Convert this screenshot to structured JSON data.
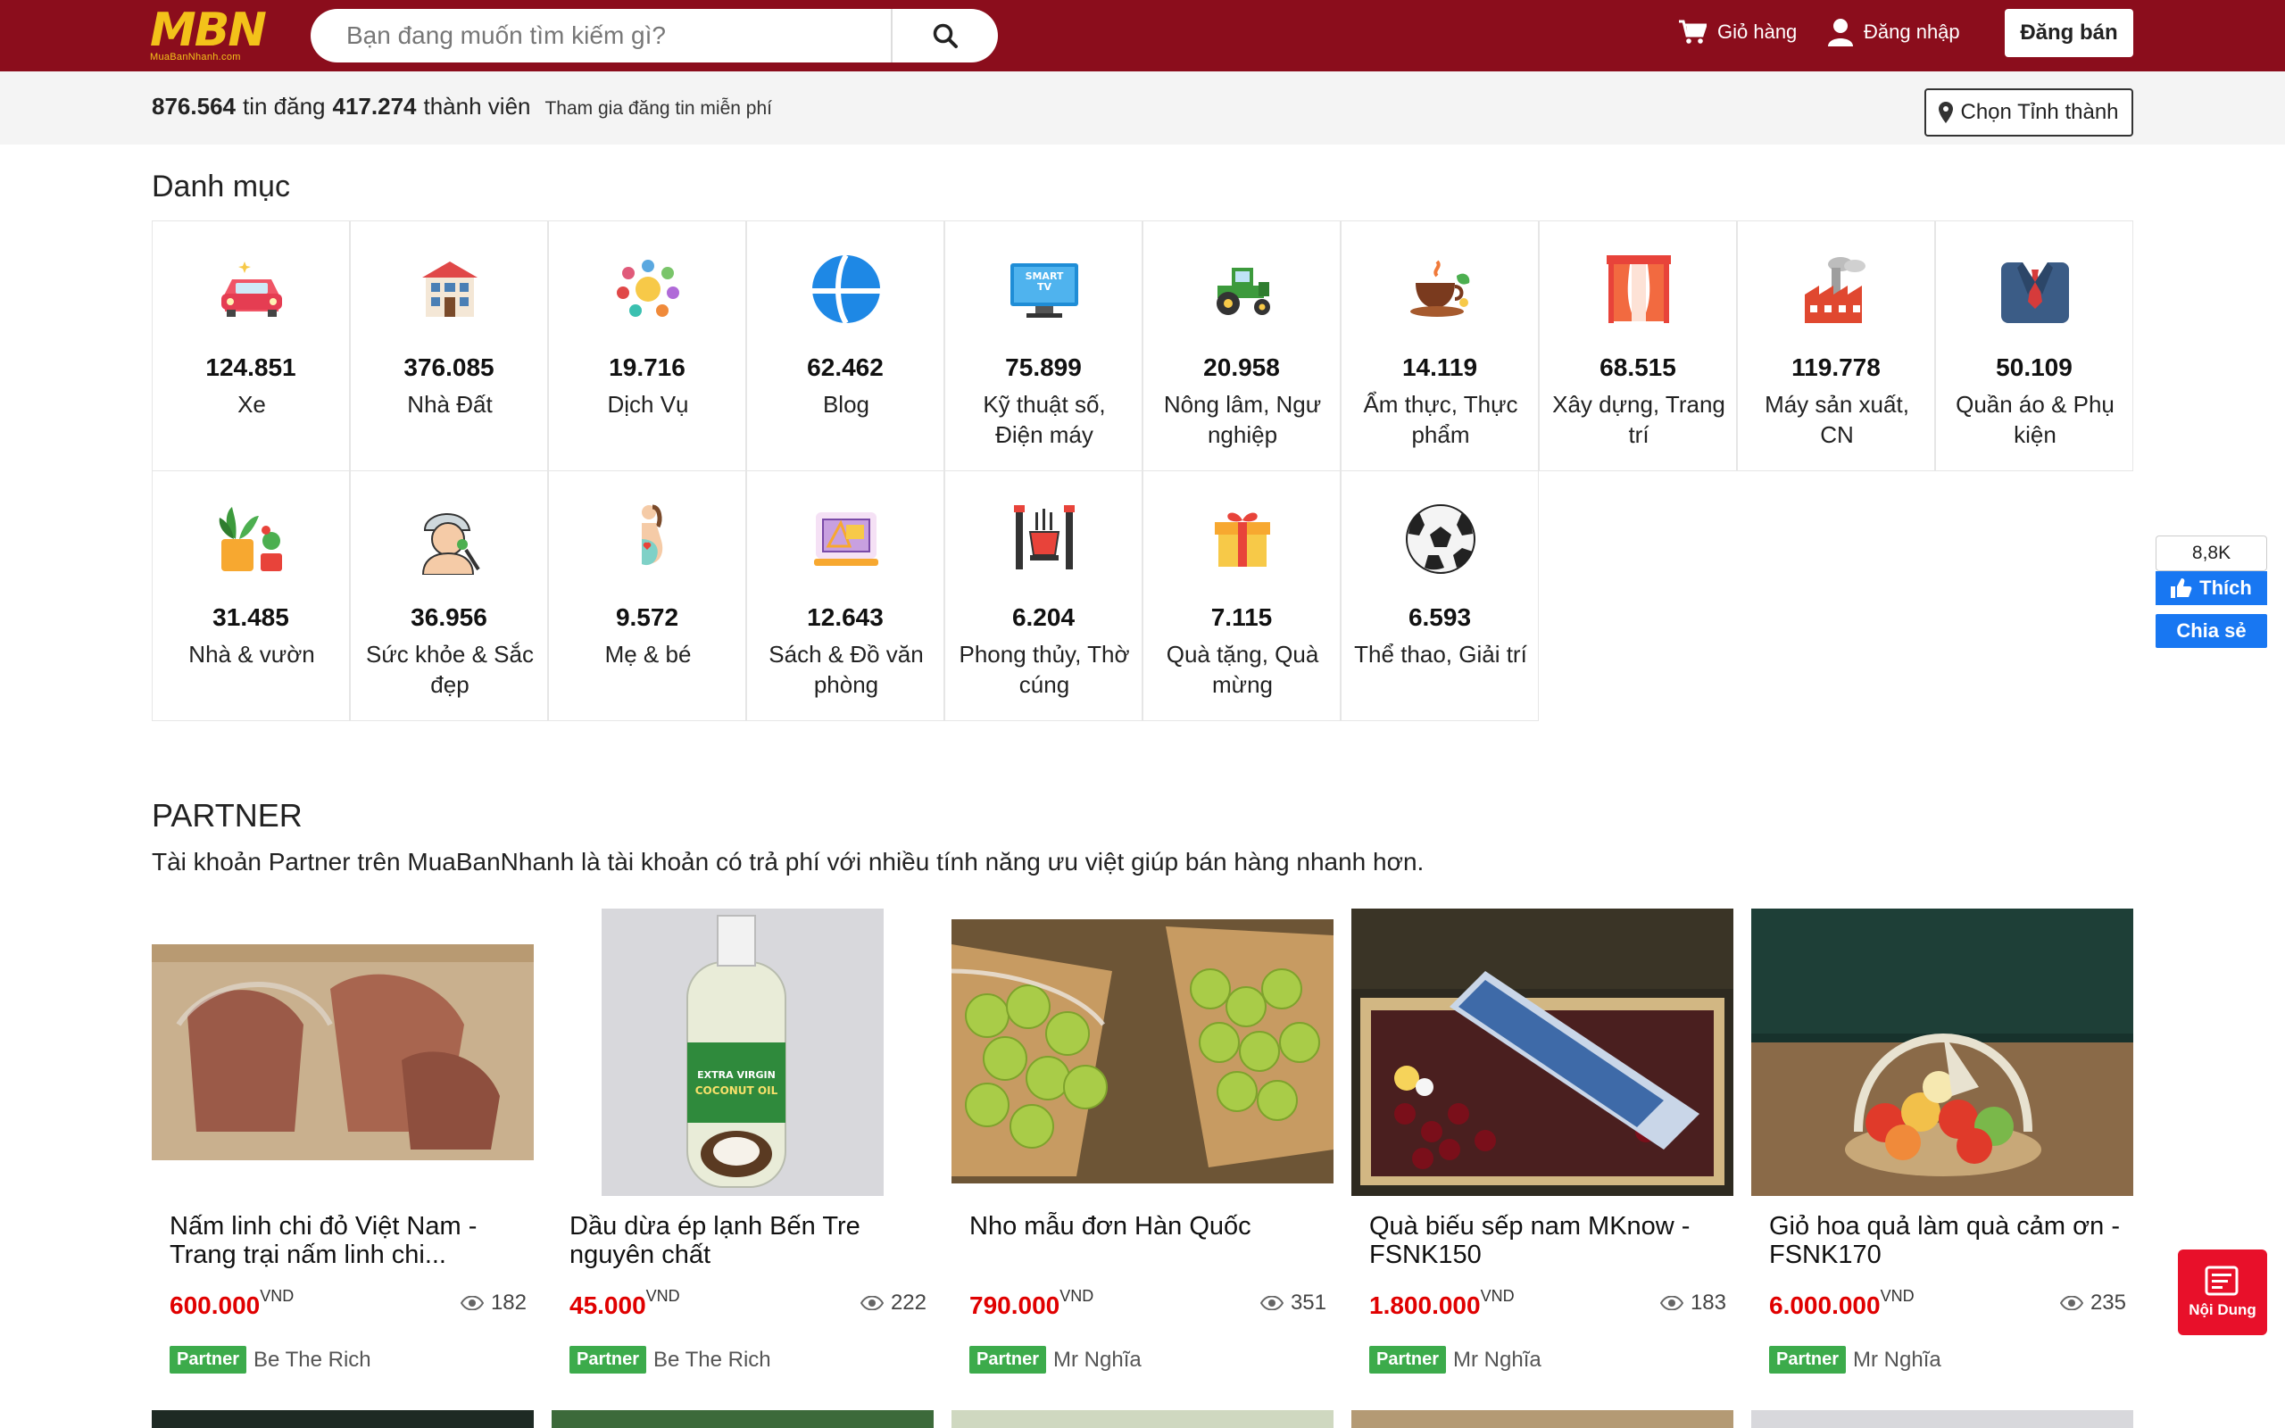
{
  "brand": {
    "logo_text": "MBN",
    "logo_sub": "MuaBanNhanh.com"
  },
  "search": {
    "placeholder": "Bạn đang muốn tìm kiếm gì?"
  },
  "header": {
    "cart_label": "Giỏ hàng",
    "login_label": "Đăng nhập",
    "sell_label": "Đăng bán"
  },
  "stats": {
    "listings": "876.564",
    "listings_label": "tin đăng",
    "members": "417.274",
    "members_label": "thành viên",
    "join_text": "Tham gia đăng tin miễn phí",
    "province_button": "Chọn Tỉnh thành"
  },
  "categories": {
    "title": "Danh mục",
    "items": [
      {
        "count": "124.851",
        "name": "Xe",
        "icon": "car-icon"
      },
      {
        "count": "376.085",
        "name": "Nhà Đất",
        "icon": "house-icon"
      },
      {
        "count": "19.716",
        "name": "Dịch Vụ",
        "icon": "services-icon"
      },
      {
        "count": "62.462",
        "name": "Blog",
        "icon": "globe-icon"
      },
      {
        "count": "75.899",
        "name": "Kỹ thuật số, Điện máy",
        "icon": "smart-tv-icon"
      },
      {
        "count": "20.958",
        "name": "Nông lâm, Ngư nghiệp",
        "icon": "tractor-icon"
      },
      {
        "count": "14.119",
        "name": "Ẩm thực, Thực phẩm",
        "icon": "food-icon"
      },
      {
        "count": "68.515",
        "name": "Xây dựng, Trang trí",
        "icon": "curtain-icon"
      },
      {
        "count": "119.778",
        "name": "Máy sản xuất, CN",
        "icon": "factory-icon"
      },
      {
        "count": "50.109",
        "name": "Quần áo & Phụ kiện",
        "icon": "suit-icon"
      },
      {
        "count": "31.485",
        "name": "Nhà & vườn",
        "icon": "plants-icon"
      },
      {
        "count": "36.956",
        "name": "Sức khỏe & Sắc đẹp",
        "icon": "beauty-icon"
      },
      {
        "count": "9.572",
        "name": "Mẹ & bé",
        "icon": "pregnant-icon"
      },
      {
        "count": "12.643",
        "name": "Sách & Đồ văn phòng",
        "icon": "office-icon"
      },
      {
        "count": "6.204",
        "name": "Phong thủy, Thờ cúng",
        "icon": "altar-icon"
      },
      {
        "count": "7.115",
        "name": "Quà tặng, Quà mừng",
        "icon": "gift-icon"
      },
      {
        "count": "6.593",
        "name": "Thể thao, Giải trí",
        "icon": "soccer-ball-icon"
      }
    ]
  },
  "social": {
    "like_count": "8,8K",
    "like_label": "Thích",
    "share_label": "Chia sẻ"
  },
  "partner": {
    "title": "PARTNER",
    "description": "Tài khoản Partner trên MuaBanNhanh là tài khoản có trả phí với nhiều tính năng ưu việt giúp bán hàng nhanh hơn.",
    "badge": "Partner",
    "currency": "VND",
    "products": [
      {
        "name": "Nấm linh chi đỏ Việt Nam - Trang trại nấm linh chi...",
        "price": "600.000",
        "views": "182",
        "seller": "Be The Rich"
      },
      {
        "name": "Dầu dừa ép lạnh Bến Tre nguyên chất",
        "price": "45.000",
        "views": "222",
        "seller": "Be The Rich"
      },
      {
        "name": "Nho mẫu đơn Hàn Quốc",
        "price": "790.000",
        "views": "351",
        "seller": "Mr Nghĩa"
      },
      {
        "name": "Quà biếu sếp nam MKnow - FSNK150",
        "price": "1.800.000",
        "views": "183",
        "seller": "Mr Nghĩa"
      },
      {
        "name": "Giỏ hoa quả làm quà cảm ơn - FSNK170",
        "price": "6.000.000",
        "views": "235",
        "seller": "Mr Nghĩa"
      }
    ]
  },
  "fab": {
    "label": "Nội Dung"
  },
  "colors": {
    "header_bg": "#8b0d1c",
    "logo": "#f3c21a",
    "price": "#e00000",
    "badge": "#3cab4b",
    "facebook": "#1877f2",
    "fab": "#e8102a"
  }
}
